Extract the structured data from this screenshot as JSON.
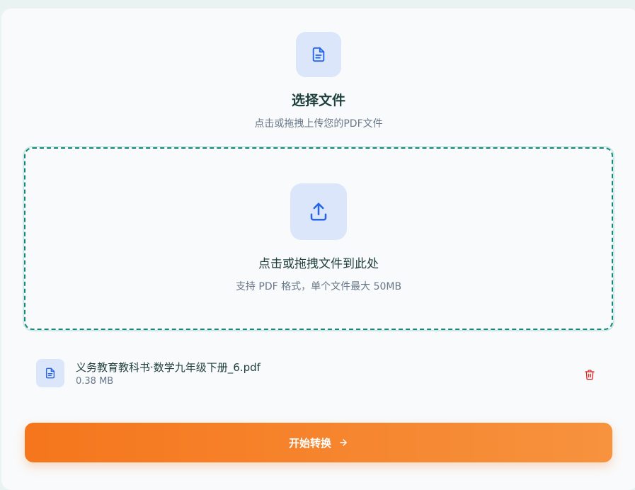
{
  "header": {
    "icon": "document-icon",
    "title": "选择文件",
    "subtitle": "点击或拖拽上传您的PDF文件"
  },
  "dropzone": {
    "icon": "upload-icon",
    "title": "点击或拖拽文件到此处",
    "hint": "支持 PDF 格式，单个文件最大 50MB"
  },
  "file": {
    "icon": "file-icon",
    "name": "义务教育教科书·数学九年级下册_6.pdf",
    "size": "0.38 MB",
    "delete_icon": "trash-icon"
  },
  "actions": {
    "convert_label": "开始转换",
    "convert_icon": "arrow-right-icon"
  },
  "colors": {
    "accent_blue": "#2563eb",
    "accent_orange": "#f5761c",
    "dashed_border": "#15877a",
    "delete_red": "#dc2626"
  }
}
